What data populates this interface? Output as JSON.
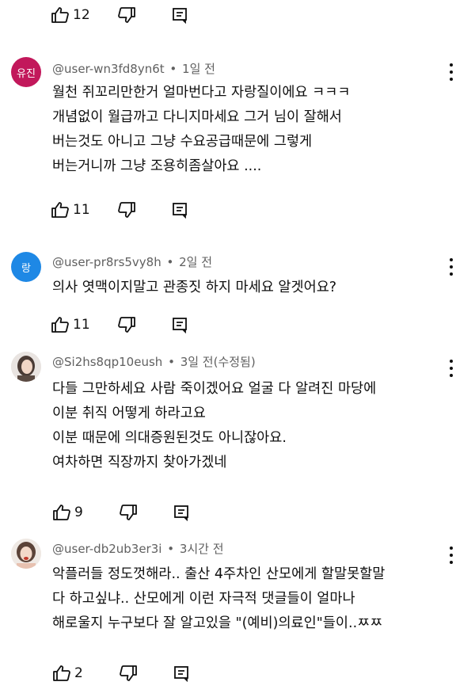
{
  "top_actions": {
    "likes": "12"
  },
  "comments": [
    {
      "avatar_text": "유진",
      "avatar_color": "#c2185b",
      "author": "@user-wn3fd8yn6t",
      "time": "1일 전",
      "lines": [
        "월천 쥐꼬리만한거 얼마번다고 자랑질이에요 ㅋㅋㅋ",
        "개념없이 월급까고 다니지마세요 그거 님이 잘해서",
        "버는것도 아니고 그냥 수요공급때문에 그렇게",
        "버는거니까 그냥 조용히좀살아요 ...."
      ],
      "likes": "11"
    },
    {
      "avatar_text": "랑",
      "avatar_color": "#1e88e5",
      "author": "@user-pr8rs5vy8h",
      "time": "2일 전",
      "lines": [
        "의사 엿맥이지말고 관종짓 하지 마세요 알겟어요?"
      ],
      "likes": "11"
    },
    {
      "avatar_text": "",
      "avatar_color": "#6b5a52",
      "author": "@Si2hs8qp10eush",
      "time": "3일 전(수정됨)",
      "lines": [
        "다들 그만하세요 사람 죽이겠어요 얼굴 다 알려진 마당에",
        "이분 취직 어떻게 하라고요",
        "이분 때문에 의대증원된것도 아니잖아요.",
        "여차하면 직장까지 찾아가겠네"
      ],
      "likes": "9"
    },
    {
      "avatar_text": "",
      "avatar_color": "#8d6e63",
      "author": "@user-db2ub3er3i",
      "time": "3시간 전",
      "lines": [
        "악플러들 정도껏해라.. 출산 4주차인 산모에게 할말못할말",
        "다 하고싶냐.. 산모에게 이런 자극적 댓글들이 얼마나",
        "해로울지 누구보다 잘 알고있을 \"(예비)의료인\"들이..ㅉㅉ"
      ],
      "likes": "2"
    }
  ]
}
